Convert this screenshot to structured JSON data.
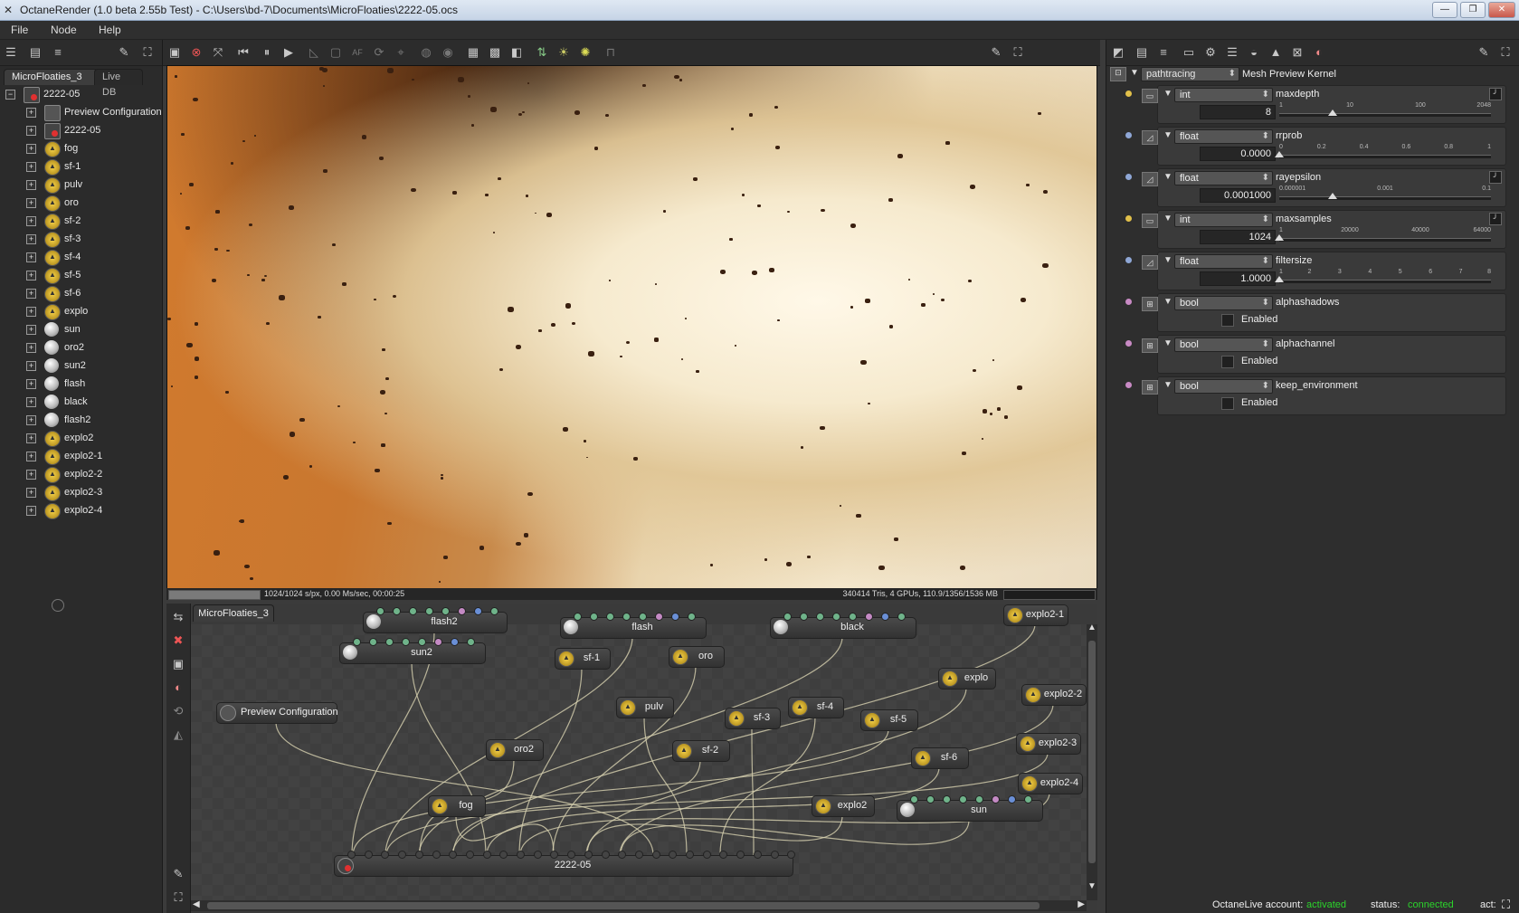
{
  "window": {
    "title": "OctaneRender (1.0 beta 2.55b Test) - C:\\Users\\bd-7\\Documents\\MicroFloaties\\2222-05.ocs"
  },
  "menu": [
    "File",
    "Node",
    "Help"
  ],
  "left": {
    "tabs": [
      "MicroFloaties_3",
      "Live DB"
    ],
    "tree_root": "2222-05",
    "tree": [
      {
        "label": "Preview Configuration",
        "icon": "config-icon"
      },
      {
        "label": "2222-05",
        "icon": "render-target-icon"
      },
      {
        "label": "fog",
        "icon": "emitter-icon"
      },
      {
        "label": "sf-1",
        "icon": "emitter-icon"
      },
      {
        "label": "pulv",
        "icon": "emitter-icon"
      },
      {
        "label": "oro",
        "icon": "emitter-icon"
      },
      {
        "label": "sf-2",
        "icon": "emitter-icon"
      },
      {
        "label": "sf-3",
        "icon": "emitter-icon"
      },
      {
        "label": "sf-4",
        "icon": "emitter-icon"
      },
      {
        "label": "sf-5",
        "icon": "emitter-icon"
      },
      {
        "label": "sf-6",
        "icon": "emitter-icon"
      },
      {
        "label": "explo",
        "icon": "emitter-icon"
      },
      {
        "label": "sun",
        "icon": "sphere-icon"
      },
      {
        "label": "oro2",
        "icon": "sphere-icon"
      },
      {
        "label": "sun2",
        "icon": "sphere-icon"
      },
      {
        "label": "flash",
        "icon": "sphere-icon"
      },
      {
        "label": "black",
        "icon": "sphere-icon"
      },
      {
        "label": "flash2",
        "icon": "sphere-icon"
      },
      {
        "label": "explo2",
        "icon": "emitter-icon"
      },
      {
        "label": "explo2-1",
        "icon": "emitter-icon"
      },
      {
        "label": "explo2-2",
        "icon": "emitter-icon"
      },
      {
        "label": "explo2-3",
        "icon": "emitter-icon"
      },
      {
        "label": "explo2-4",
        "icon": "emitter-icon"
      }
    ]
  },
  "render": {
    "status_left": "1024/1024 s/px, 0.00 Ms/sec, 00:00:25",
    "status_right": "340414 Tris, 4 GPUs, 110.9/1356/1536 MB",
    "progress": 1.0
  },
  "graph": {
    "tab": "MicroFloaties_3",
    "nodes": [
      {
        "id": "flash2",
        "label": "flash2",
        "icon": "sphere-icon"
      },
      {
        "id": "flash",
        "label": "flash",
        "icon": "sphere-icon"
      },
      {
        "id": "black",
        "label": "black",
        "icon": "sphere-icon"
      },
      {
        "id": "explo2-1",
        "label": "explo2-1",
        "icon": "emitter-icon"
      },
      {
        "id": "sun2",
        "label": "sun2",
        "icon": "sphere-icon"
      },
      {
        "id": "sf-1",
        "label": "sf-1",
        "icon": "emitter-icon"
      },
      {
        "id": "oro",
        "label": "oro",
        "icon": "emitter-icon"
      },
      {
        "id": "explo",
        "label": "explo",
        "icon": "emitter-icon"
      },
      {
        "id": "explo2-2",
        "label": "explo2-2",
        "icon": "emitter-icon"
      },
      {
        "id": "preview",
        "label": "Preview Configuration",
        "icon": "config-icon"
      },
      {
        "id": "pulv",
        "label": "pulv",
        "icon": "emitter-icon"
      },
      {
        "id": "sf-4",
        "label": "sf-4",
        "icon": "emitter-icon"
      },
      {
        "id": "sf-3",
        "label": "sf-3",
        "icon": "emitter-icon"
      },
      {
        "id": "sf-5",
        "label": "sf-5",
        "icon": "emitter-icon"
      },
      {
        "id": "explo2-3",
        "label": "explo2-3",
        "icon": "emitter-icon"
      },
      {
        "id": "oro2",
        "label": "oro2",
        "icon": "emitter-icon"
      },
      {
        "id": "sf-2",
        "label": "sf-2",
        "icon": "emitter-icon"
      },
      {
        "id": "sf-6",
        "label": "sf-6",
        "icon": "emitter-icon"
      },
      {
        "id": "explo2-4",
        "label": "explo2-4",
        "icon": "emitter-icon"
      },
      {
        "id": "fog",
        "label": "fog",
        "icon": "emitter-icon"
      },
      {
        "id": "explo2",
        "label": "explo2",
        "icon": "emitter-icon"
      },
      {
        "id": "sun",
        "label": "sun",
        "icon": "sphere-icon"
      },
      {
        "id": "2222-05",
        "label": "2222-05",
        "icon": "render-target-icon"
      }
    ]
  },
  "kernel": {
    "type": "pathtracing",
    "label": "Mesh Preview Kernel"
  },
  "params": [
    {
      "type": "int",
      "name": "maxdepth",
      "value": "8",
      "ticks": [
        "1",
        "10",
        "100",
        "2048"
      ],
      "level": 0.25
    },
    {
      "type": "float",
      "name": "rrprob",
      "value": "0.0000",
      "ticks": [
        "0",
        "0.2",
        "0.4",
        "0.6",
        "0.8",
        "1"
      ],
      "level": 0.0
    },
    {
      "type": "float",
      "name": "rayepsilon",
      "value": "0.0001000",
      "ticks": [
        "0.000001",
        "0.001",
        "0.1"
      ],
      "level": 0.25
    },
    {
      "type": "int",
      "name": "maxsamples",
      "value": "1024",
      "ticks": [
        "1",
        "20000",
        "40000",
        "64000"
      ],
      "level": 0.0
    },
    {
      "type": "float",
      "name": "filtersize",
      "value": "1.0000",
      "ticks": [
        "1",
        "2",
        "3",
        "4",
        "5",
        "6",
        "7",
        "8"
      ],
      "level": 0.0
    },
    {
      "type": "bool",
      "name": "alphashadows",
      "checkbox": "Enabled"
    },
    {
      "type": "bool",
      "name": "alphachannel",
      "checkbox": "Enabled"
    },
    {
      "type": "bool",
      "name": "keep_environment",
      "checkbox": "Enabled"
    }
  ],
  "footer": {
    "account_label": "OctaneLive account:",
    "account_value": "activated",
    "status_label": "status:",
    "status_value": "connected",
    "act_label": "act:"
  },
  "colors": {
    "accent_green": "#2bd42b",
    "pin_green": "#6fb38a",
    "pin_pink": "#c48ac4",
    "pin_blue": "#6a8fd6",
    "wire": "#d8d2b0"
  }
}
